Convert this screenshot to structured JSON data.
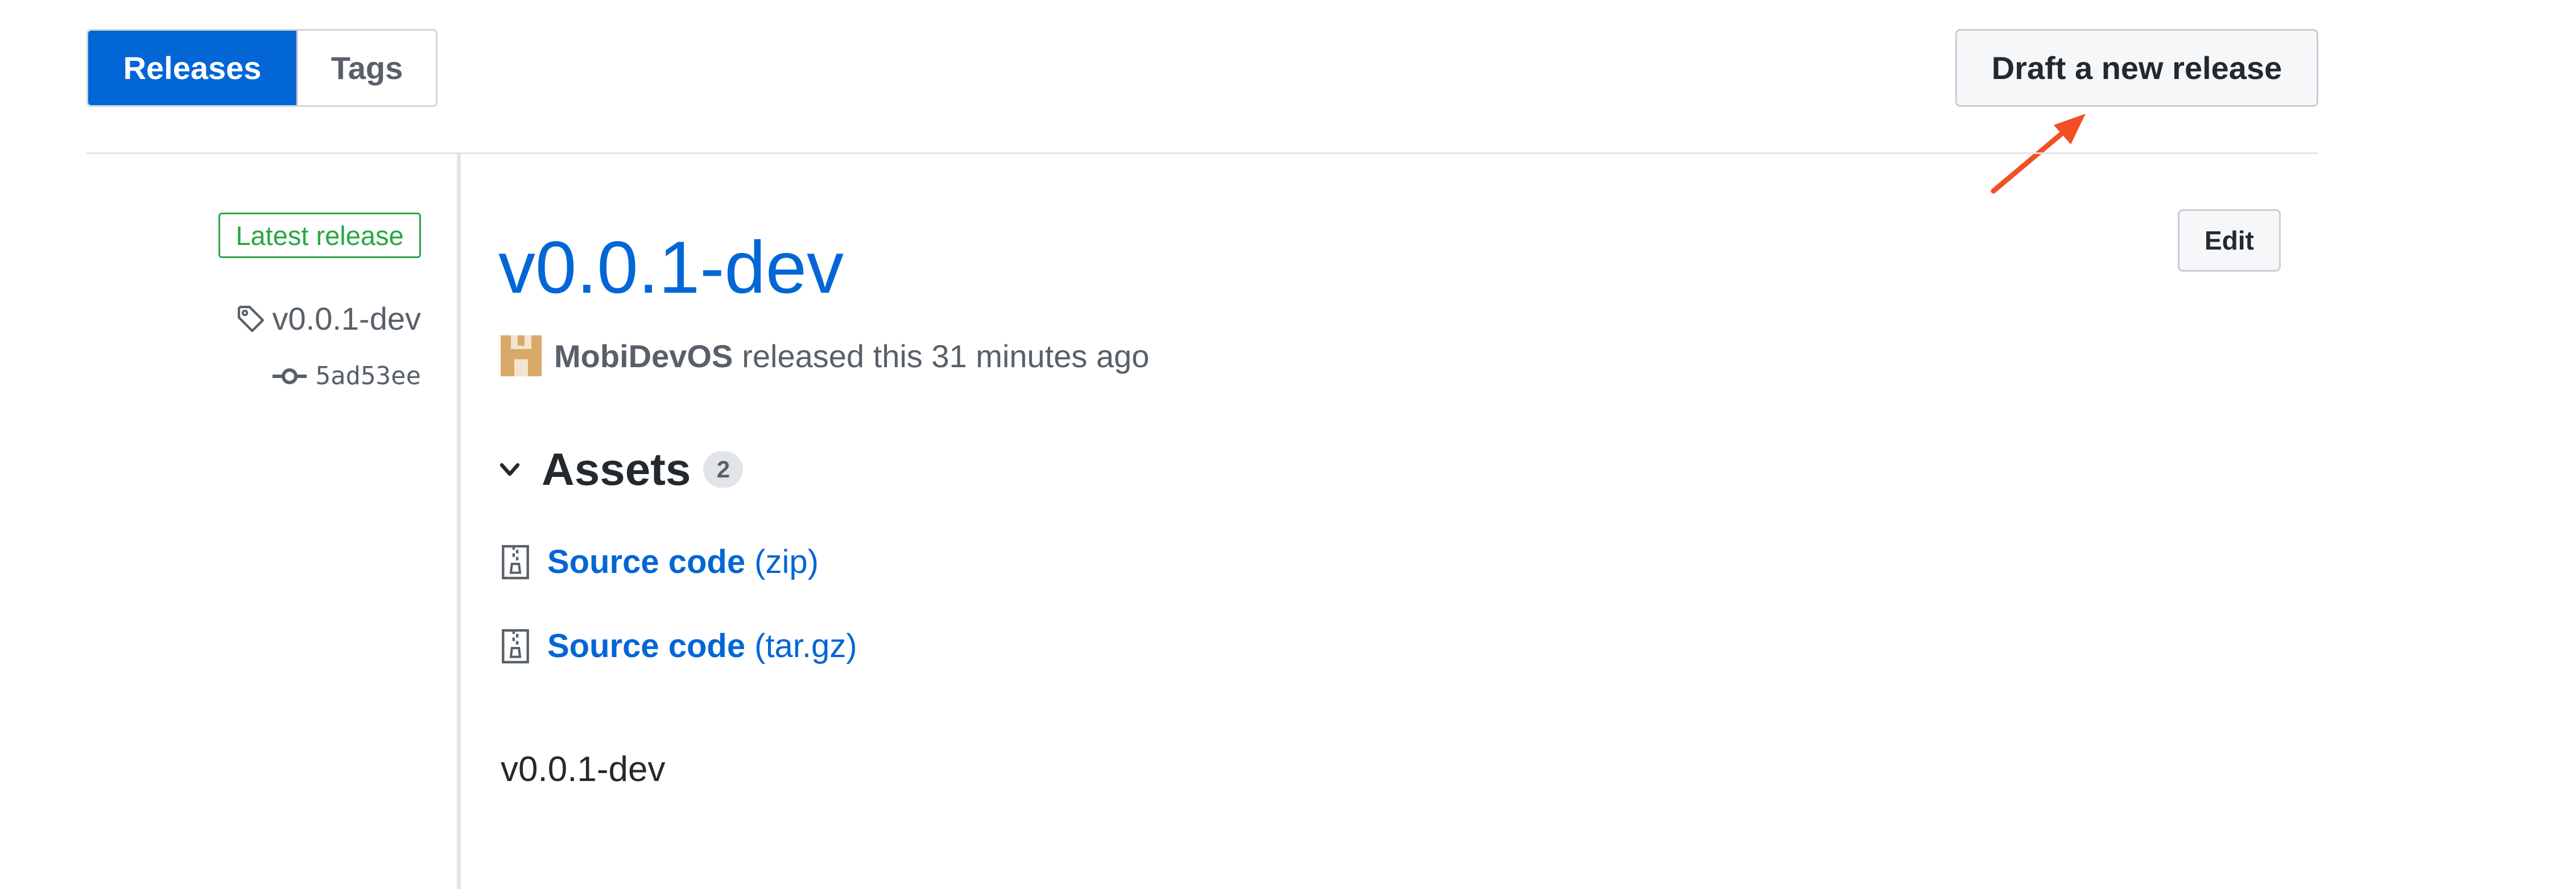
{
  "tabs": {
    "releases": "Releases",
    "tags": "Tags"
  },
  "toolbar": {
    "draft_label": "Draft a new release"
  },
  "sidebar": {
    "badge": "Latest release",
    "tag": "v0.0.1-dev",
    "commit": "5ad53ee"
  },
  "release": {
    "title": "v0.0.1-dev",
    "edit_label": "Edit",
    "author": "MobiDevOS",
    "released_text": "released this 31 minutes ago",
    "assets_title": "Assets",
    "assets_count": "2",
    "assets": [
      {
        "label": "Source code",
        "ext": "(zip)"
      },
      {
        "label": "Source code",
        "ext": "(tar.gz)"
      }
    ],
    "notes": "v0.0.1-dev"
  },
  "icons": {
    "tag": "tag-icon",
    "commit": "git-commit-icon",
    "avatar": "avatar",
    "chevron": "chevron-down-icon",
    "archive": "file-zip-icon",
    "annotation": "red-arrow-annotation"
  },
  "colors": {
    "link": "#0366d6",
    "selected_tab": "#0366d6",
    "badge": "#28a745",
    "arrow": "#f24f24",
    "avatar": "#d9a96a"
  }
}
